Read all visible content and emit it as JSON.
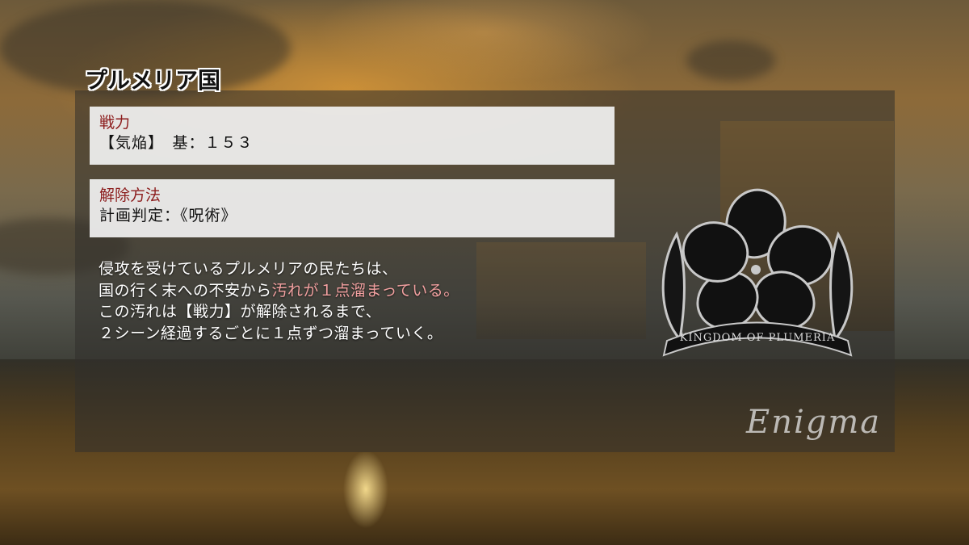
{
  "title": "プルメリア国",
  "cards": [
    {
      "heading": "戦力",
      "body": "【気焔】　基：１５３"
    },
    {
      "heading": "解除方法",
      "body": "計画判定：《呪術》"
    }
  ],
  "description": {
    "line1": "侵攻を受けているプルメリアの民たちは、",
    "line2_pre": "国の行く末への不安から",
    "line2_highlight": "汚れが１点溜まっている。",
    "line3": "この汚れは【戦力】が解除されるまで、",
    "line4": "２シーン経過するごとに１点ずつ溜まっていく。"
  },
  "emblem": {
    "banner_text": "KINGDOM OF PLUMERIA"
  },
  "brand": "Enigma",
  "colors": {
    "heading_red": "#8c1c1c",
    "highlight_pink": "#f2a0a0"
  }
}
